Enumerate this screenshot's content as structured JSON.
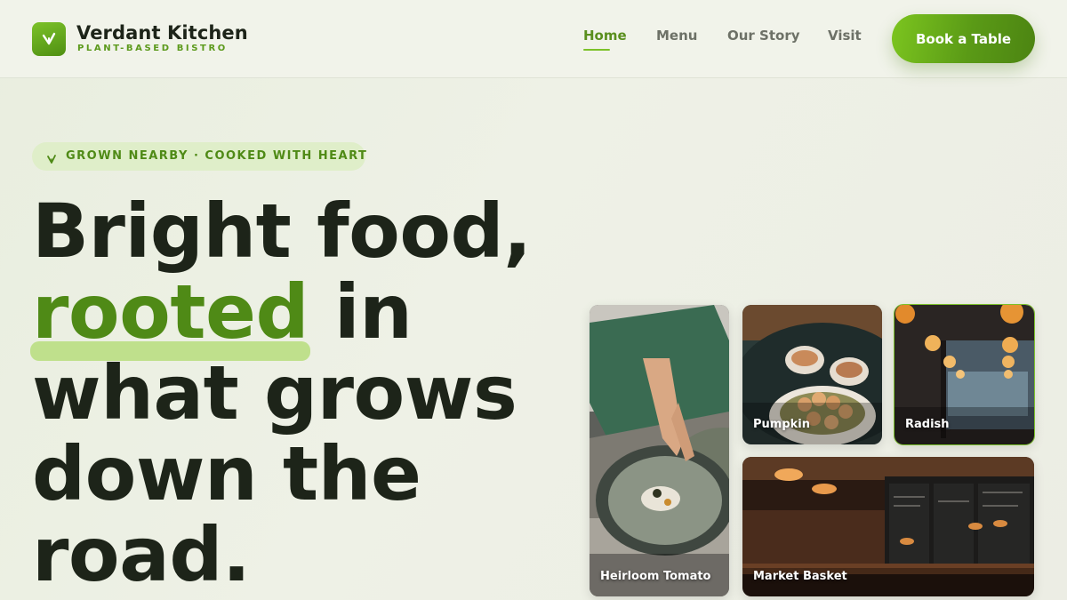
{
  "brand": {
    "name": "Verdant Kitchen",
    "tagline": "PLANT-BASED BISTRO",
    "logo_icon": "leaf-icon"
  },
  "nav": {
    "items": [
      {
        "label": "Home",
        "active": true
      },
      {
        "label": "Menu",
        "active": false
      },
      {
        "label": "Our Story",
        "active": false
      },
      {
        "label": "Visit",
        "active": false
      }
    ],
    "cta_label": "Book a Table"
  },
  "hero": {
    "eyebrow": "GROWN NEARBY · COOKED WITH HEART",
    "eyebrow_icon": "sprout-icon",
    "headline": {
      "line1": "Bright food,",
      "highlight": "rooted",
      "line2_rest": " in",
      "line3": "what grows",
      "line4": "down the",
      "line5": "road."
    }
  },
  "gallery": {
    "tiles": [
      {
        "label": "Heirloom Tomato",
        "image": "chef plating dish photo"
      },
      {
        "label": "Pumpkin",
        "image": "plates of dumplings photo"
      },
      {
        "label": "Radish",
        "image": "dining room with pendant lamps photo"
      },
      {
        "label": "Market Basket",
        "image": "bar interior with chalkboard menus photo"
      }
    ]
  },
  "colors": {
    "accent": "#5a9a16",
    "accent_light": "#7cc22a",
    "highlight": "#bfe08c",
    "ink": "#1d2419",
    "nav_muted": "#6d7167"
  }
}
